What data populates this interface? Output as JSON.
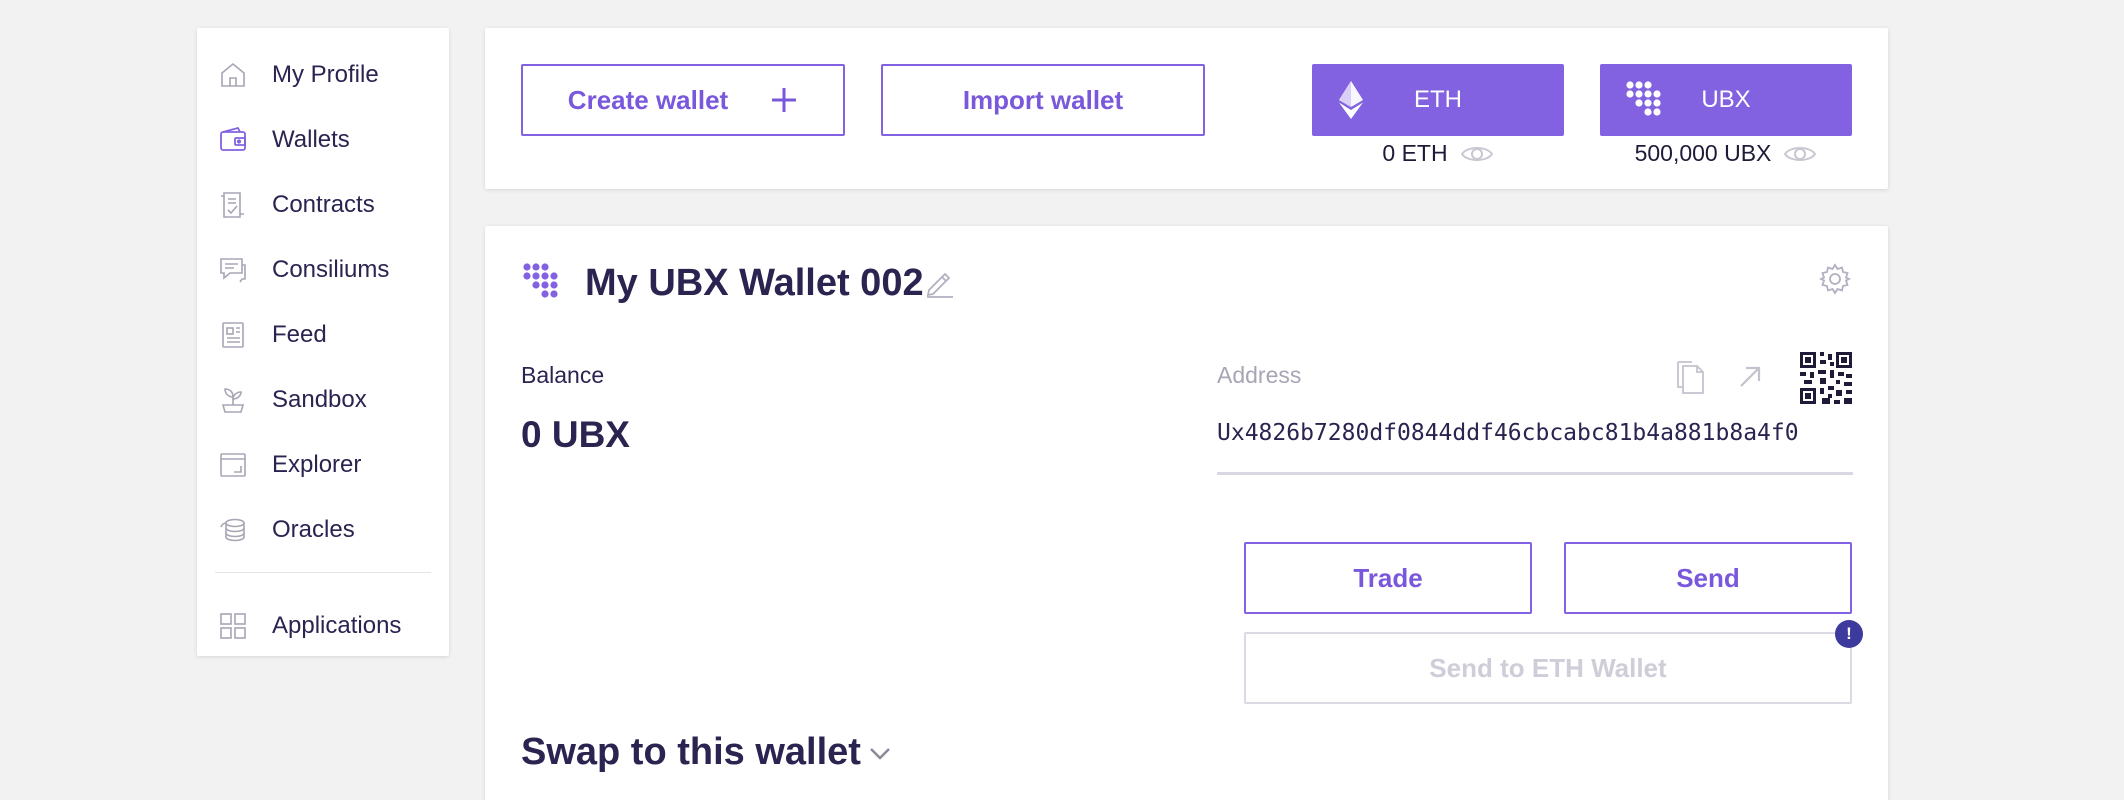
{
  "sidebar": {
    "items": [
      {
        "label": "My Profile",
        "icon": "home-icon"
      },
      {
        "label": "Wallets",
        "icon": "wallet-icon",
        "active": true
      },
      {
        "label": "Contracts",
        "icon": "contract-icon"
      },
      {
        "label": "Consiliums",
        "icon": "chat-icon"
      },
      {
        "label": "Feed",
        "icon": "newspaper-icon"
      },
      {
        "label": "Sandbox",
        "icon": "sprout-icon"
      },
      {
        "label": "Explorer",
        "icon": "window-icon"
      },
      {
        "label": "Oracles",
        "icon": "coins-icon"
      }
    ],
    "applications": {
      "label": "Applications",
      "icon": "grid-icon"
    }
  },
  "toolbar": {
    "create_wallet_label": "Create wallet",
    "import_wallet_label": "Import wallet",
    "tokens": [
      {
        "name": "ETH",
        "balance": "0 ETH",
        "icon": "ethereum-icon"
      },
      {
        "name": "UBX",
        "balance": "500,000 UBX",
        "icon": "ubx-logo-icon"
      }
    ]
  },
  "wallet": {
    "title": "My UBX Wallet 002",
    "balance_label": "Balance",
    "balance_value": "0 UBX",
    "address_label": "Address",
    "address_value": "Ux4826b7280df0844ddf46cbcabc81b4a881b8a4f0",
    "trade_label": "Trade",
    "send_label": "Send",
    "send_eth_label": "Send to ETH Wallet",
    "alert_badge": "!"
  },
  "swap": {
    "title": "Swap to this wallet"
  },
  "colors": {
    "accent": "#8262e0",
    "text": "#2b2350",
    "background": "#f2f2f2",
    "badge": "#3d3a9e",
    "disabled": "#cfcdd8"
  }
}
